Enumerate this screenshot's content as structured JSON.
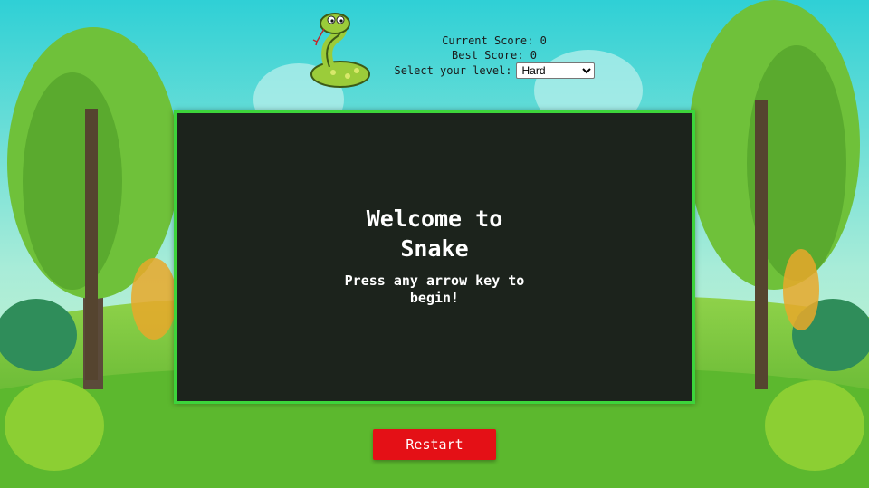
{
  "header": {
    "current_score_label": "Current Score:",
    "current_score": "0",
    "best_score_label": "Best Score:",
    "best_score": "0",
    "level_label": "Select your level:",
    "level_selected": "Hard"
  },
  "board": {
    "welcome_title": "Welcome to Snake",
    "welcome_subtitle": "Press any arrow key to begin!"
  },
  "controls": {
    "restart_label": "Restart"
  },
  "colors": {
    "board_bg": "#1c231c",
    "board_border": "#3dd43b",
    "restart_bg": "#e41016",
    "sky_top": "#35d3d8",
    "grass": "#7cc83a"
  },
  "icons": {
    "logo": "snake-icon"
  }
}
